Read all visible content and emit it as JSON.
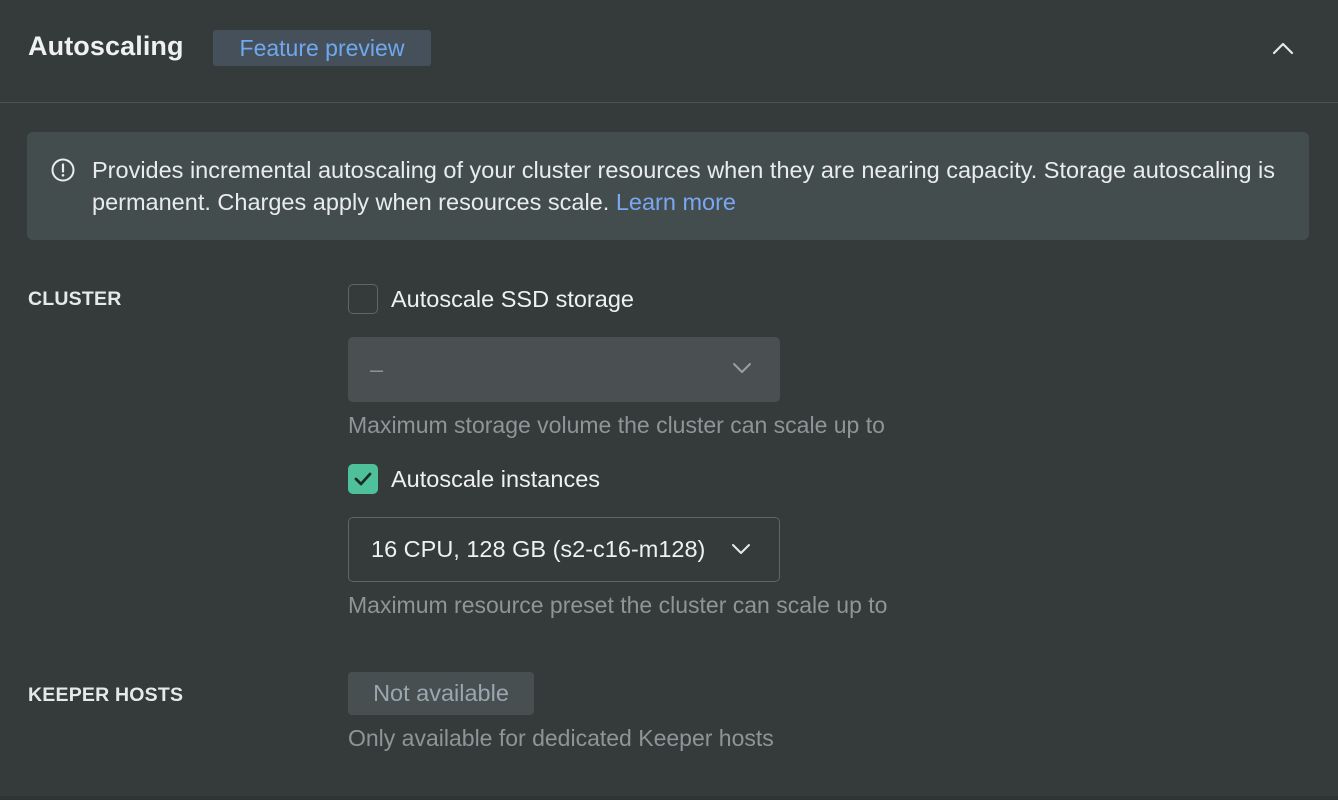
{
  "header": {
    "title": "Autoscaling",
    "badge": "Feature preview",
    "collapse_icon": "chevron-up-icon"
  },
  "info": {
    "icon": "info-circle-icon",
    "text": "Provides incremental autoscaling of your cluster resources when they are nearing capacity. Storage autoscaling is permanent. Charges apply when resources scale.",
    "link": "Learn more"
  },
  "cluster": {
    "label": "CLUSTER",
    "storage": {
      "checkbox_label": "Autoscale SSD storage",
      "checked": false,
      "select_value": "–",
      "hint": "Maximum storage volume the cluster can scale up to"
    },
    "instances": {
      "checkbox_label": "Autoscale instances",
      "checked": true,
      "select_value": "16 CPU, 128 GB (s2-c16-m128)",
      "hint": "Maximum resource preset the cluster can scale up to"
    }
  },
  "keeper": {
    "label": "KEEPER HOSTS",
    "badge": "Not available",
    "hint": "Only available for dedicated Keeper hosts"
  },
  "colors": {
    "background": "#353a3b",
    "accent_blue": "#7aa7f3",
    "check_green": "#4fc19a"
  }
}
